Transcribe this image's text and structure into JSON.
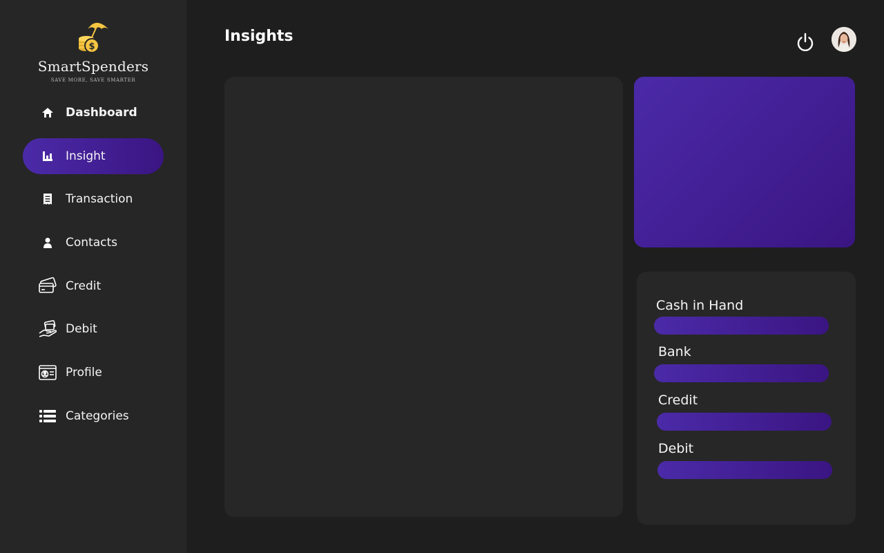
{
  "app": {
    "brand_name": "SmartSpenders",
    "tagline": "SAVE MORE, SAVE SMARTER"
  },
  "sidebar": {
    "items": [
      {
        "label": "Dashboard",
        "icon": "home-icon"
      },
      {
        "label": "Insight",
        "icon": "bar-chart-icon",
        "active": true
      },
      {
        "label": "Transaction",
        "icon": "receipt-icon"
      },
      {
        "label": "Contacts",
        "icon": "person-icon"
      },
      {
        "label": "Credit",
        "icon": "credit-cards-icon"
      },
      {
        "label": "Debit",
        "icon": "hand-card-icon"
      },
      {
        "label": "Profile",
        "icon": "id-card-icon"
      },
      {
        "label": "Categories",
        "icon": "list-icon"
      }
    ]
  },
  "header": {
    "title": "Insights",
    "power_icon": "power-icon",
    "avatar_icon": "user-avatar"
  },
  "accounts": {
    "items": [
      {
        "label": "Cash in Hand"
      },
      {
        "label": "Bank"
      },
      {
        "label": "Credit"
      },
      {
        "label": "Debit"
      }
    ]
  },
  "colors": {
    "background": "#1e1e1e",
    "sidebar": "#262626",
    "panel": "#272727",
    "accent_start": "#4b2aa8",
    "accent_end": "#3a1582",
    "logo_gold": "#f5c542"
  }
}
